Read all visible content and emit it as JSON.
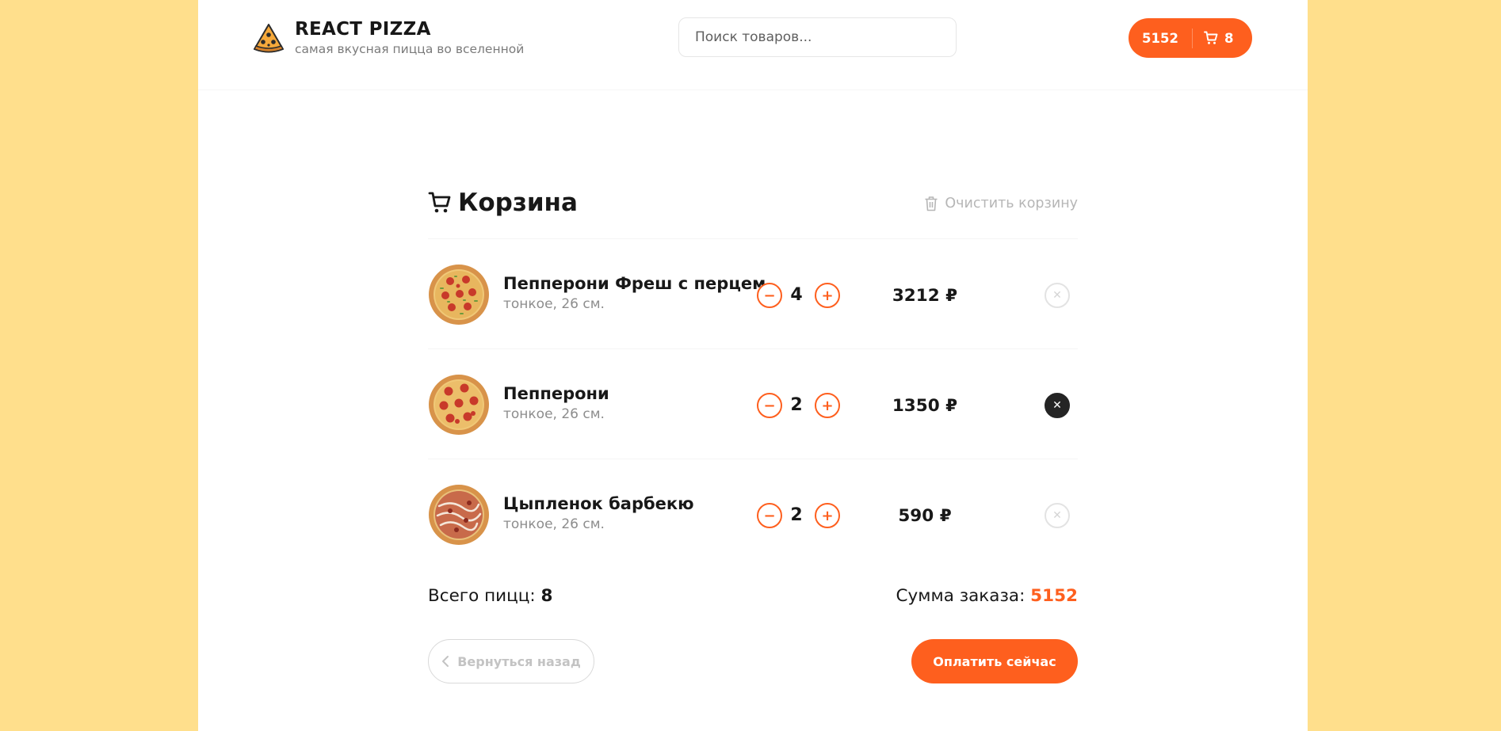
{
  "header": {
    "title": "REACT PIZZA",
    "subtitle": "самая вкусная пицца во вселенной",
    "search_placeholder": "Поиск товаров...",
    "cart_total": "5152",
    "cart_count": "8"
  },
  "cart": {
    "title": "Корзина",
    "clear_label": "Очистить корзину",
    "items": [
      {
        "name": "Пепперони Фреш с перцем",
        "desc": "тонкое, 26 см.",
        "qty": "4",
        "price": "3212 ₽"
      },
      {
        "name": "Пепперони",
        "desc": "тонкое, 26 см.",
        "qty": "2",
        "price": "1350 ₽"
      },
      {
        "name": "Цыпленок барбекю",
        "desc": "тонкое, 26 см.",
        "qty": "2",
        "price": "590 ₽"
      }
    ],
    "count_label": "Всего пицц: ",
    "count_value": "8",
    "sum_label": "Сумма заказа: ",
    "sum_value": "5152",
    "back_label": "Вернуться назад",
    "pay_label": "Оплатить сейчас"
  },
  "colors": {
    "accent": "#FE5F1E",
    "page_bg": "#FFDF8C",
    "dark": "#242424"
  }
}
